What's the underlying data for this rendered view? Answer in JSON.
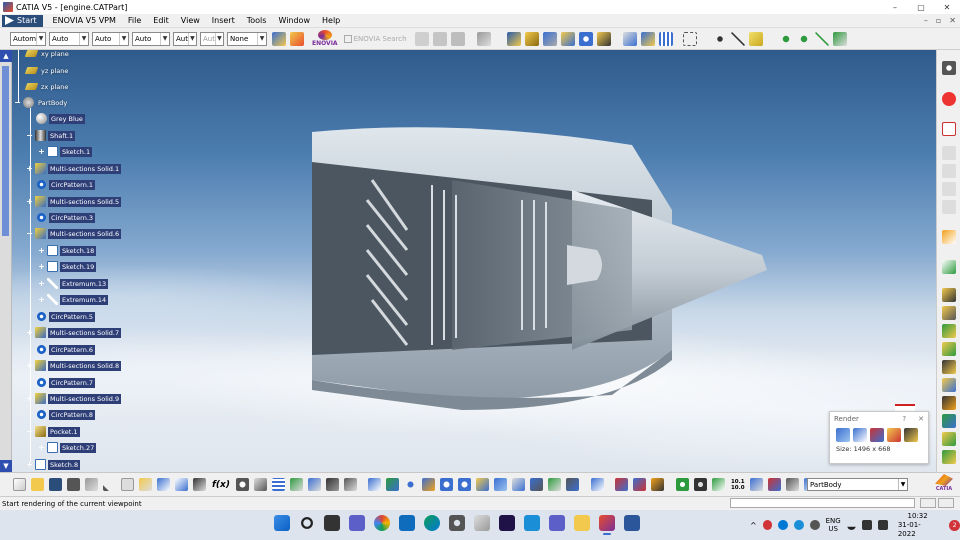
{
  "window": {
    "title": "CATIA V5 - [engine.CATPart]",
    "controls": [
      "–",
      "▢",
      "✕"
    ]
  },
  "menubar": {
    "start": "Start",
    "items": [
      "ENOVIA V5 VPM",
      "File",
      "Edit",
      "View",
      "Insert",
      "Tools",
      "Window",
      "Help"
    ],
    "mdi_controls": [
      "–",
      "▫",
      "✕"
    ]
  },
  "toolbar_top": {
    "combos": [
      "Autom",
      "Auto",
      "Auto",
      "Auto",
      "Aut",
      "Aut",
      "None"
    ],
    "enovia_label": "ENOVIA",
    "enovia_search": "ENOVIA Search"
  },
  "spec_tree": {
    "nodes": [
      {
        "label": "xy plane",
        "icon": "plane-icon"
      },
      {
        "label": "yz plane",
        "icon": "plane-icon"
      },
      {
        "label": "zx plane",
        "icon": "plane-icon"
      },
      {
        "label": "PartBody",
        "icon": "body-icon"
      },
      {
        "label": "Grey Blue",
        "icon": "material-icon"
      },
      {
        "label": "Shaft.1",
        "icon": "shaft-icon"
      },
      {
        "label": "Sketch.1",
        "icon": "sketch-icon"
      },
      {
        "label": "Multi-sections Solid.1",
        "icon": "multi-sections-solid-icon"
      },
      {
        "label": "CircPattern.1",
        "icon": "circular-pattern-icon"
      },
      {
        "label": "Multi-sections Solid.5",
        "icon": "multi-sections-solid-icon"
      },
      {
        "label": "CircPattern.3",
        "icon": "circular-pattern-icon"
      },
      {
        "label": "Multi-sections Solid.6",
        "icon": "multi-sections-solid-icon"
      },
      {
        "label": "Sketch.18",
        "icon": "sketch-icon"
      },
      {
        "label": "Sketch.19",
        "icon": "sketch-icon"
      },
      {
        "label": "Extremum.13",
        "icon": "extremum-icon"
      },
      {
        "label": "Extremum.14",
        "icon": "extremum-icon"
      },
      {
        "label": "CircPattern.5",
        "icon": "circular-pattern-icon"
      },
      {
        "label": "Multi-sections Solid.7",
        "icon": "multi-sections-solid-icon"
      },
      {
        "label": "CircPattern.6",
        "icon": "circular-pattern-icon"
      },
      {
        "label": "Multi-sections Solid.8",
        "icon": "multi-sections-solid-icon"
      },
      {
        "label": "CircPattern.7",
        "icon": "circular-pattern-icon"
      },
      {
        "label": "Multi-sections Solid.9",
        "icon": "multi-sections-solid-icon"
      },
      {
        "label": "CircPattern.8",
        "icon": "circular-pattern-icon"
      },
      {
        "label": "Pocket.1",
        "icon": "pocket-icon"
      },
      {
        "label": "Sketch.27",
        "icon": "sketch-icon"
      },
      {
        "label": "Sketch.8",
        "icon": "sketch-icon"
      }
    ]
  },
  "render_panel": {
    "title": "Render",
    "help": "?",
    "close": "✕",
    "size_text": "Size: 1496 x 668"
  },
  "toolbar_bottom": {
    "fx_label": "f(x)",
    "scale_label_top": "10.1",
    "scale_label_bottom": "10.0"
  },
  "current_body_combo": "PartBody",
  "catia_logo_text": "CATIA",
  "status": {
    "message": "Start rendering of the current viewpoint"
  },
  "taskbar": {
    "language_top": "ENG",
    "language_bottom": "US",
    "time": "10:32",
    "date": "31-01-2022",
    "notification_count": "2"
  },
  "colors": {
    "tree_label_bg": "#2e3f78",
    "start_bg": "#2b4d7a",
    "nacelle": "#b8c4ce"
  }
}
